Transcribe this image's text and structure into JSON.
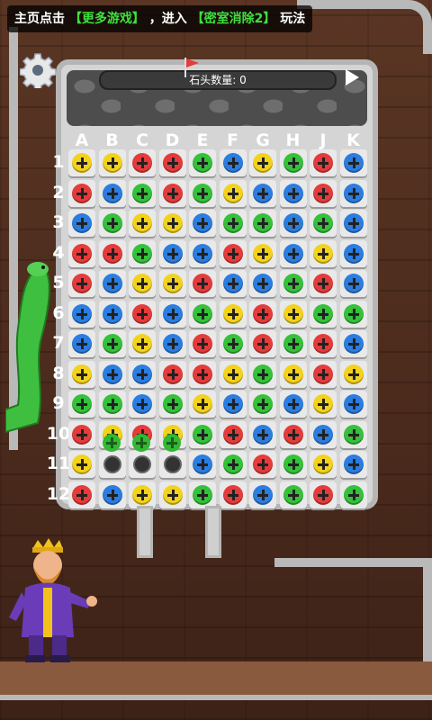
{
  "hint": {
    "part1": "主页点击",
    "link1": "【更多游戏】",
    "part2": "，进入",
    "link2": "【密室消除2】",
    "part3": "玩法"
  },
  "counter": {
    "label": "石头数量: 0"
  },
  "columns": [
    "A",
    "B",
    "C",
    "D",
    "E",
    "F",
    "G",
    "H",
    "J",
    "K"
  ],
  "rows": [
    "1",
    "2",
    "3",
    "4",
    "5",
    "6",
    "7",
    "8",
    "9",
    "10",
    "11",
    "12"
  ],
  "colors": {
    "yellow": "#f3d21d",
    "red": "#e53b3b",
    "green": "#35c13a",
    "blue": "#2b7de0"
  },
  "grid": [
    [
      "yellow",
      "yellow",
      "red",
      "red",
      "green",
      "blue",
      "yellow",
      "green",
      "red",
      "blue"
    ],
    [
      "red",
      "blue",
      "green",
      "red",
      "green",
      "yellow",
      "blue",
      "blue",
      "red",
      "blue"
    ],
    [
      "blue",
      "green",
      "yellow",
      "yellow",
      "blue",
      "green",
      "green",
      "blue",
      "green",
      "blue"
    ],
    [
      "red",
      "red",
      "green",
      "blue",
      "blue",
      "red",
      "yellow",
      "blue",
      "yellow",
      "blue"
    ],
    [
      "red",
      "blue",
      "yellow",
      "yellow",
      "red",
      "blue",
      "blue",
      "green",
      "red",
      "blue"
    ],
    [
      "blue",
      "blue",
      "red",
      "blue",
      "green",
      "yellow",
      "red",
      "yellow",
      "green",
      "green"
    ],
    [
      "blue",
      "green",
      "yellow",
      "blue",
      "red",
      "green",
      "red",
      "green",
      "red",
      "blue"
    ],
    [
      "yellow",
      "blue",
      "blue",
      "red",
      "red",
      "yellow",
      "green",
      "yellow",
      "red",
      "yellow"
    ],
    [
      "green",
      "green",
      "blue",
      "green",
      "yellow",
      "blue",
      "green",
      "blue",
      "yellow",
      "blue"
    ],
    [
      "red",
      "yellow",
      "red",
      "yellow",
      "green",
      "red",
      "blue",
      "red",
      "blue",
      "green"
    ],
    [
      "yellow",
      "hole",
      "hole",
      "hole",
      "blue",
      "green",
      "red",
      "green",
      "yellow",
      "blue"
    ],
    [
      "red",
      "blue",
      "yellow",
      "yellow",
      "green",
      "red",
      "blue",
      "green",
      "red",
      "green"
    ]
  ]
}
